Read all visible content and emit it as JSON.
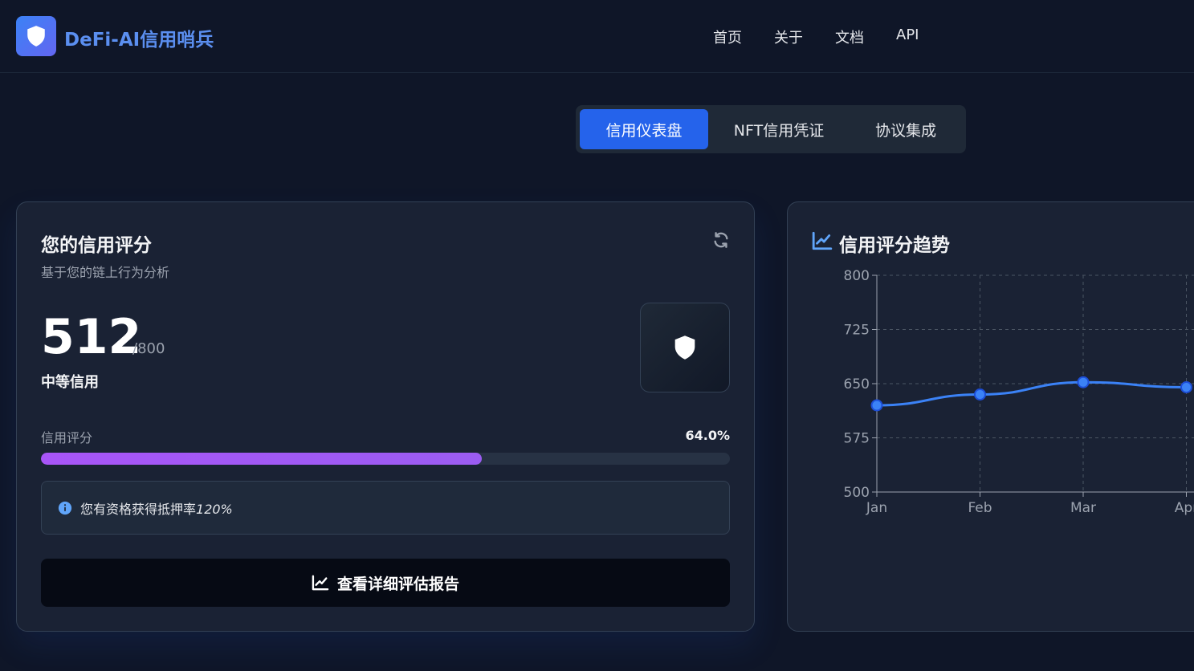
{
  "header": {
    "brand": "DeFi-AI信用哨兵",
    "nav": [
      "首页",
      "关于",
      "文档",
      "API"
    ]
  },
  "tabs": [
    {
      "label": "信用仪表盘",
      "active": true
    },
    {
      "label": "NFT信用凭证",
      "active": false
    },
    {
      "label": "协议集成",
      "active": false
    }
  ],
  "score_card": {
    "title": "您的信用评分",
    "subtitle": "基于您的链上行为分析",
    "score": "512",
    "max": "/800",
    "level": "中等信用",
    "bar_label": "信用评分",
    "bar_value": "64.0%",
    "bar_fraction": 0.64,
    "info_text": "您有资格获得抵押率",
    "info_rate": "120%",
    "report_button": "查看详细评估报告"
  },
  "trend_card": {
    "title": "信用评分趋势"
  },
  "chart_data": {
    "type": "line",
    "categories": [
      "Jan",
      "Feb",
      "Mar",
      "Apr"
    ],
    "values": [
      620,
      635,
      652,
      645
    ],
    "yticks": [
      800,
      725,
      650,
      575,
      500
    ],
    "ylim": [
      500,
      800
    ],
    "grid": true,
    "color": "#3b82f6"
  },
  "colors": {
    "accent": "#2563eb",
    "progress": "#a855f7",
    "brand": "#5b8ff0"
  }
}
